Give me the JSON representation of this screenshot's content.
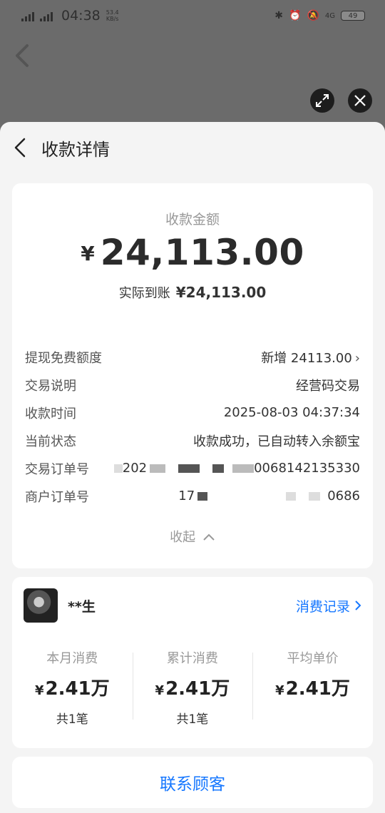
{
  "status_bar": {
    "network_1": "4GHD",
    "network_2": "4GHD",
    "time": "04:38",
    "speed_value": "53.4",
    "speed_unit": "KB/s",
    "network_right": "4G",
    "battery": "49"
  },
  "header": {
    "title": "收款详情"
  },
  "amount": {
    "label": "收款金额",
    "currency": "¥",
    "value": "24,113.00",
    "actual_label": "实际到账",
    "actual_value": "¥24,113.00"
  },
  "details": [
    {
      "key": "提现免费额度",
      "value": "新增 24113.00"
    },
    {
      "key": "交易说明",
      "value": "经营码交易"
    },
    {
      "key": "收款时间",
      "value": "2025-08-03 04:37:34"
    },
    {
      "key": "当前状态",
      "value": "收款成功，已自动转入余额宝"
    },
    {
      "key": "交易订单号",
      "value_prefix": "202",
      "value_suffix": "0068142135330"
    },
    {
      "key": "商户订单号",
      "value_prefix": "17",
      "value_suffix": "0686"
    }
  ],
  "collapse_label": "收起",
  "customer": {
    "name": "**生",
    "record_link": "消费记录",
    "stats": [
      {
        "label": "本月消费",
        "currency": "¥",
        "value": "2.41万",
        "count": "共1笔"
      },
      {
        "label": "累计消费",
        "currency": "¥",
        "value": "2.41万",
        "count": "共1笔"
      },
      {
        "label": "平均单价",
        "currency": "¥",
        "value": "2.41万",
        "count": ""
      }
    ]
  },
  "contact_button": "联系顾客"
}
